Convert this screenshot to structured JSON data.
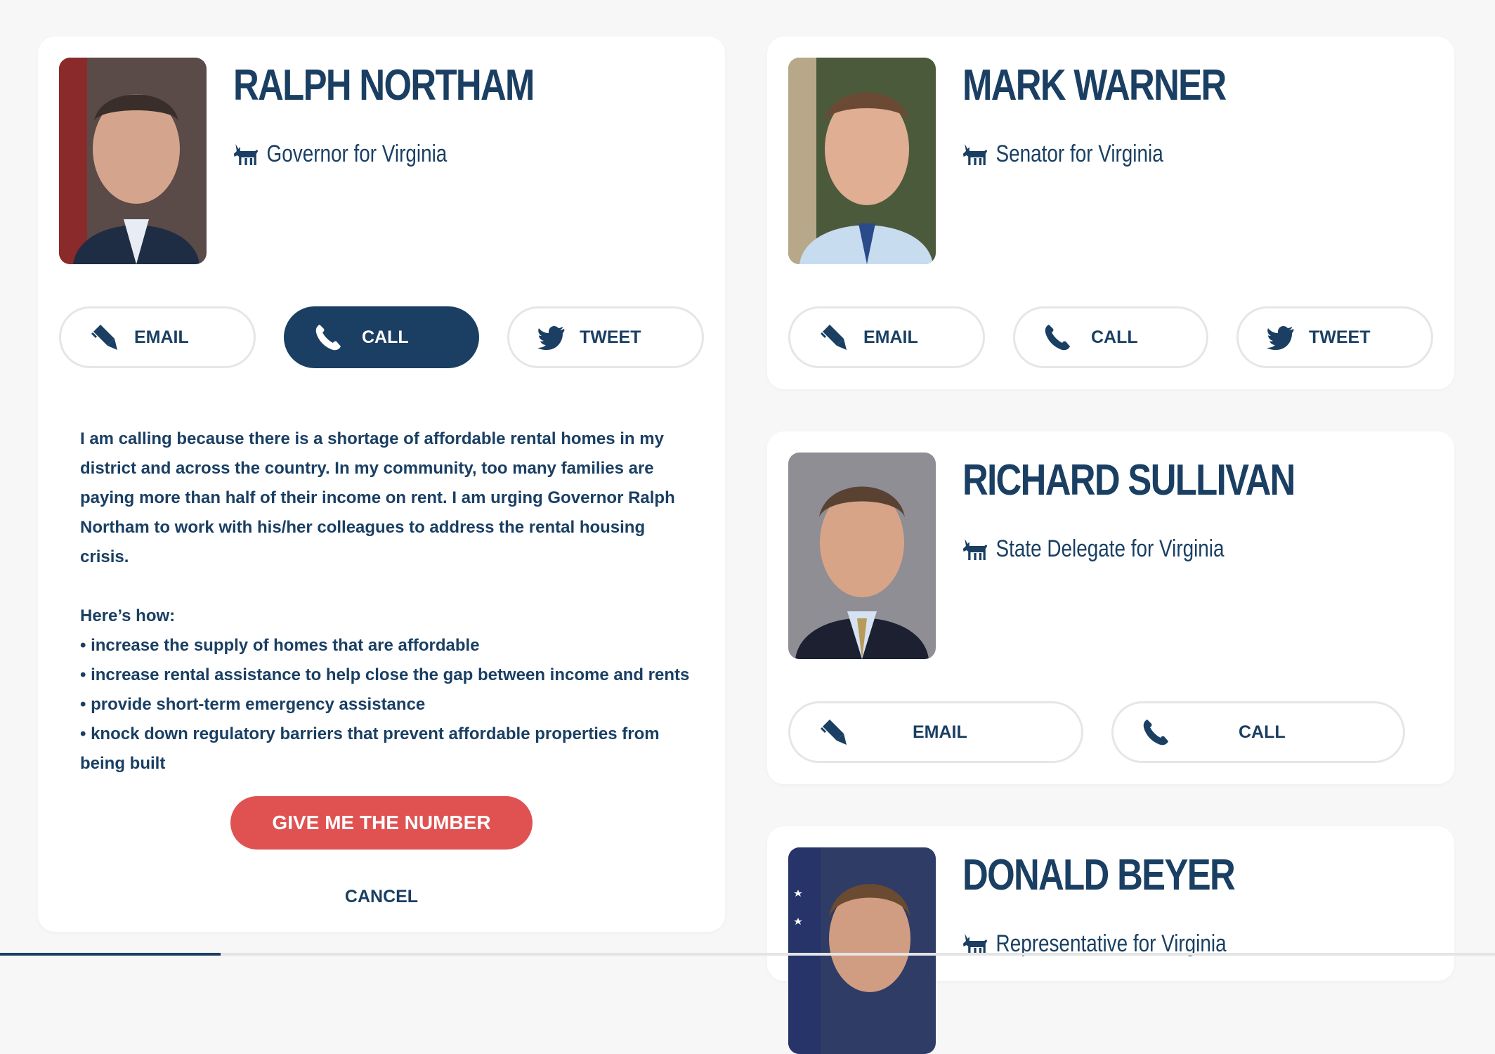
{
  "icons": {
    "party": "donkey-icon",
    "email": "pencil-icon",
    "call": "phone-icon",
    "tweet": "twitter-bird-icon"
  },
  "colors": {
    "navy": "#1a3f63",
    "accent_red": "#e05252",
    "card": "#ffffff",
    "background": "#f7f7f7"
  },
  "representatives": [
    {
      "name": "RALPH NORTHAM",
      "role": "Governor for Virginia",
      "buttons": {
        "email": "EMAIL",
        "call": "CALL",
        "tweet": "TWEET"
      },
      "active_action": "call",
      "call_script": {
        "intro": "I am calling because there is a shortage of affordable rental homes in my district and across the country. In my community, too many families are paying more than half of their income on rent. I am urging Governor Ralph Northam to work with his/her colleagues to address the rental housing crisis.",
        "how_title": "Here’s how:",
        "bullets": [
          "• increase the supply of homes that are affordable",
          "• increase rental assistance to help close the gap between income and rents",
          "• provide short-term emergency assistance",
          "• knock down regulatory barriers that prevent affordable properties from being built"
        ]
      },
      "primary_action": "GIVE ME THE NUMBER",
      "cancel": "CANCEL"
    },
    {
      "name": "MARK WARNER",
      "role": "Senator for Virginia",
      "buttons": {
        "email": "EMAIL",
        "call": "CALL",
        "tweet": "TWEET"
      }
    },
    {
      "name": "RICHARD SULLIVAN",
      "role": "State Delegate for Virginia",
      "buttons": {
        "email": "EMAIL",
        "call": "CALL"
      }
    },
    {
      "name": "DONALD BEYER",
      "role": "Representative for Virginia"
    }
  ]
}
